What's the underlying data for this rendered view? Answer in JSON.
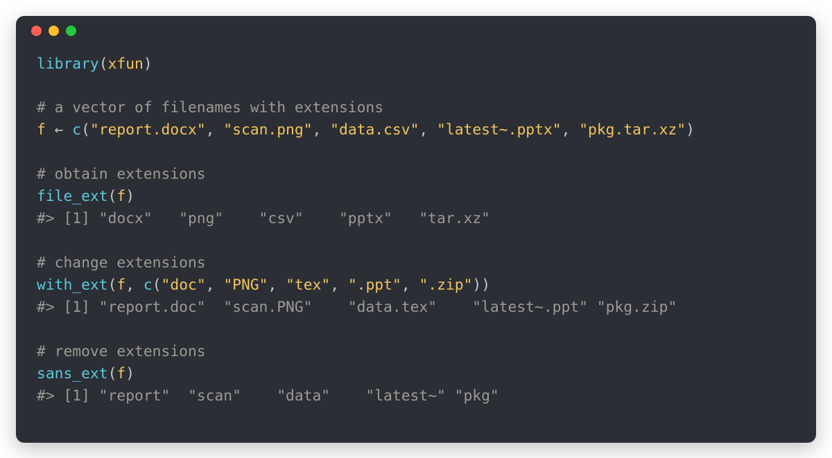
{
  "window": {
    "dot_red": "red",
    "dot_yellow": "yellow",
    "dot_green": "green"
  },
  "code": {
    "l1": {
      "fn": "library",
      "p1": "(",
      "arg": "xfun",
      "p2": ")"
    },
    "l2": "",
    "l3": "# a vector of filenames with extensions",
    "l4": {
      "lhs": "f",
      "arrow": " ← ",
      "fn": "c",
      "p1": "(",
      "s1": "\"report.docx\"",
      "c1": ", ",
      "s2": "\"scan.png\"",
      "c2": ", ",
      "s3": "\"data.csv\"",
      "c3": ", ",
      "s4": "\"latest~.pptx\"",
      "c4": ", ",
      "s5": "\"pkg.tar.xz\"",
      "p2": ")"
    },
    "l5": "",
    "l6": "# obtain extensions",
    "l7": {
      "fn": "file_ext",
      "p1": "(",
      "arg": "f",
      "p2": ")"
    },
    "l8": "#> [1] \"docx\"   \"png\"    \"csv\"    \"pptx\"   \"tar.xz\"",
    "l9": "",
    "l10": "# change extensions",
    "l11": {
      "fn": "with_ext",
      "p1": "(",
      "arg": "f",
      "c0": ", ",
      "fn2": "c",
      "p2": "(",
      "s1": "\"doc\"",
      "c1": ", ",
      "s2": "\"PNG\"",
      "c2": ", ",
      "s3": "\"tex\"",
      "c3": ", ",
      "s4": "\".ppt\"",
      "c4": ", ",
      "s5": "\".zip\"",
      "p3": "))"
    },
    "l12": "#> [1] \"report.doc\"  \"scan.PNG\"    \"data.tex\"    \"latest~.ppt\" \"pkg.zip\"",
    "l13": "",
    "l14": "# remove extensions",
    "l15": {
      "fn": "sans_ext",
      "p1": "(",
      "arg": "f",
      "p2": ")"
    },
    "l16": "#> [1] \"report\"  \"scan\"    \"data\"    \"latest~\" \"pkg\""
  }
}
